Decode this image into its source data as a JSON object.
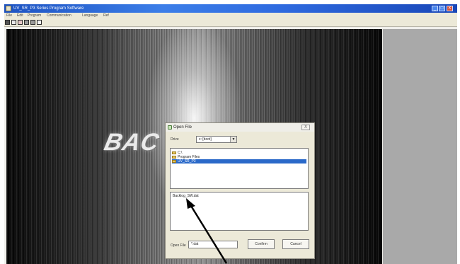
{
  "window": {
    "title": "UV_SR_P3 Series Program Software",
    "controls": [
      "_",
      "□",
      "X"
    ]
  },
  "menubar": {
    "items": [
      "File",
      "Edit",
      "Program",
      "Communication",
      "Language",
      "Ref"
    ]
  },
  "toolbar": {
    "buttons": [
      "new-icon",
      "open-icon",
      "edit-icon",
      "grid-icon",
      "grid-icon",
      "chart-icon"
    ]
  },
  "splash": {
    "logo_text": "BAC"
  },
  "dialog": {
    "title": "Open File",
    "close_label": "X",
    "drive_label": "Drive",
    "drive_value": "c: [boot]",
    "directories": [
      {
        "label": "C:\\",
        "selected": false
      },
      {
        "label": "Program Files",
        "selected": false
      },
      {
        "label": "UV_SR_P3",
        "selected": true
      }
    ],
    "files": [
      "Backlog_SW.dat"
    ],
    "open_file_label": "Open File",
    "open_file_value": "*.dat",
    "confirm_label": "Confirm",
    "cancel_label": "Cancel"
  },
  "colors": {
    "titlebar": "#2f6be0",
    "selection": "#2a69c9",
    "panel": "#a9a9a9"
  }
}
